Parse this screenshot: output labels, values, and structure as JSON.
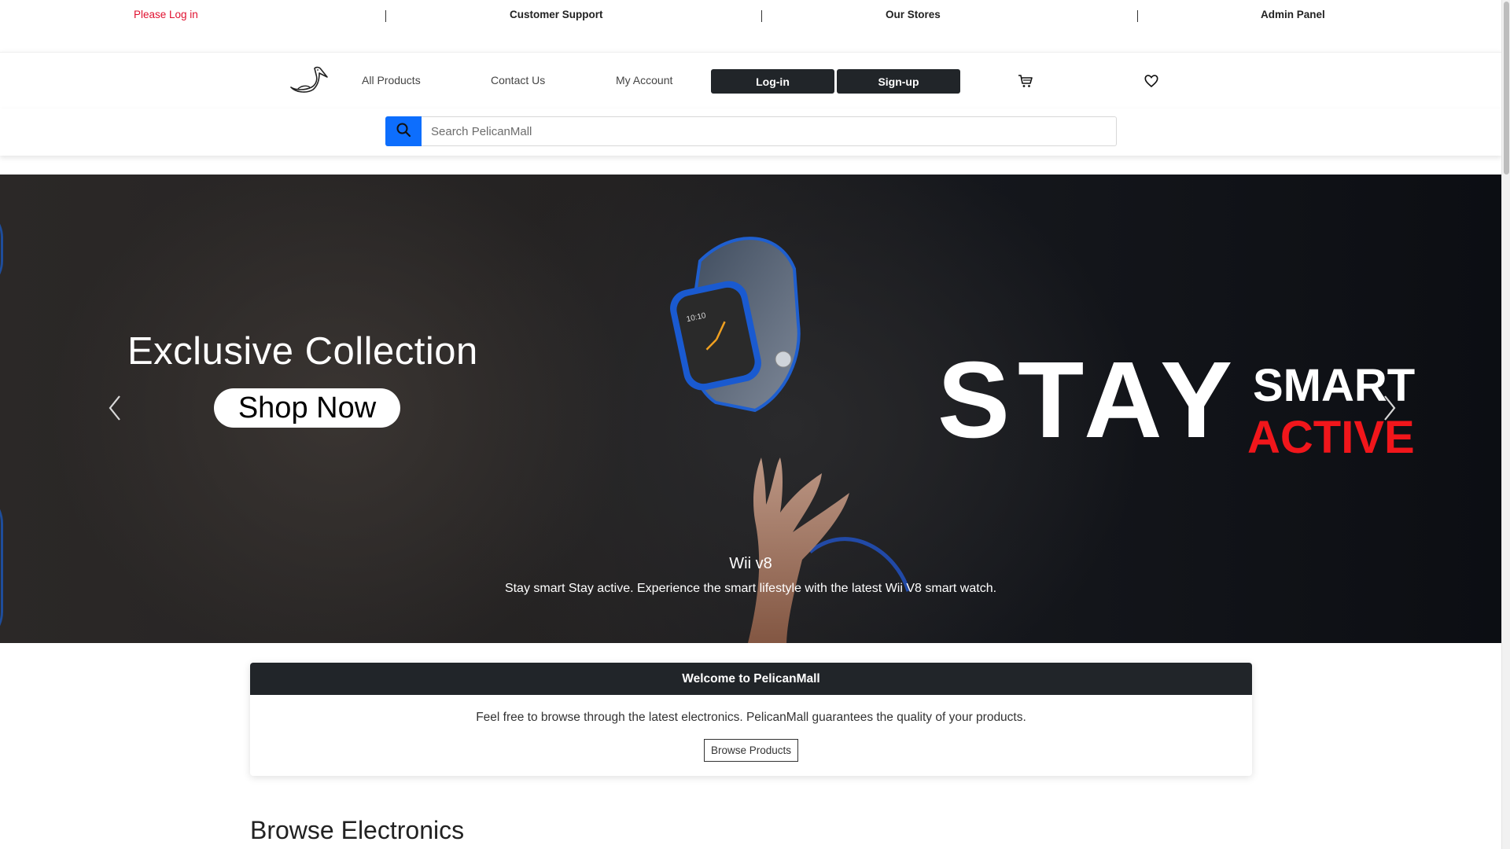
{
  "topbar": {
    "login_warning": "Please Log in",
    "support": "Customer Support",
    "stores": "Our Stores",
    "admin": "Admin Panel",
    "separator": "|"
  },
  "nav": {
    "logo_icon": "pelican-logo-icon",
    "all_products": "All Products",
    "contact_us": "Contact Us",
    "my_account": "My Account",
    "login": "Log-in",
    "signup": "Sign-up",
    "cart_icon": "cart-icon",
    "wishlist_icon": "heart-icon"
  },
  "search": {
    "placeholder": "Search PelicanMall",
    "button_icon": "search-icon",
    "accent": "#0d6efd"
  },
  "hero": {
    "headline": "Exclusive Collection",
    "cta": "Shop Now",
    "stay": "STAY",
    "smart": "SMART",
    "active": "ACTIVE",
    "active_color": "#f1161b",
    "watch_time": "10:10",
    "caption_title": "Wii v8",
    "caption_text": "Stay smart Stay active. Experience the smart lifestyle with the latest Wii V8 smart watch.",
    "prev_icon": "chevron-left-icon",
    "next_icon": "chevron-right-icon"
  },
  "welcome": {
    "header": "Welcome to PelicanMall",
    "body": "Feel free to browse through the latest electronics. PelicanMall guarantees the quality of your products.",
    "button": "Browse Products"
  },
  "sections": {
    "browse_title": "Browse Electronics"
  },
  "colors": {
    "dark": "#212529",
    "warning": "#e0102f"
  }
}
